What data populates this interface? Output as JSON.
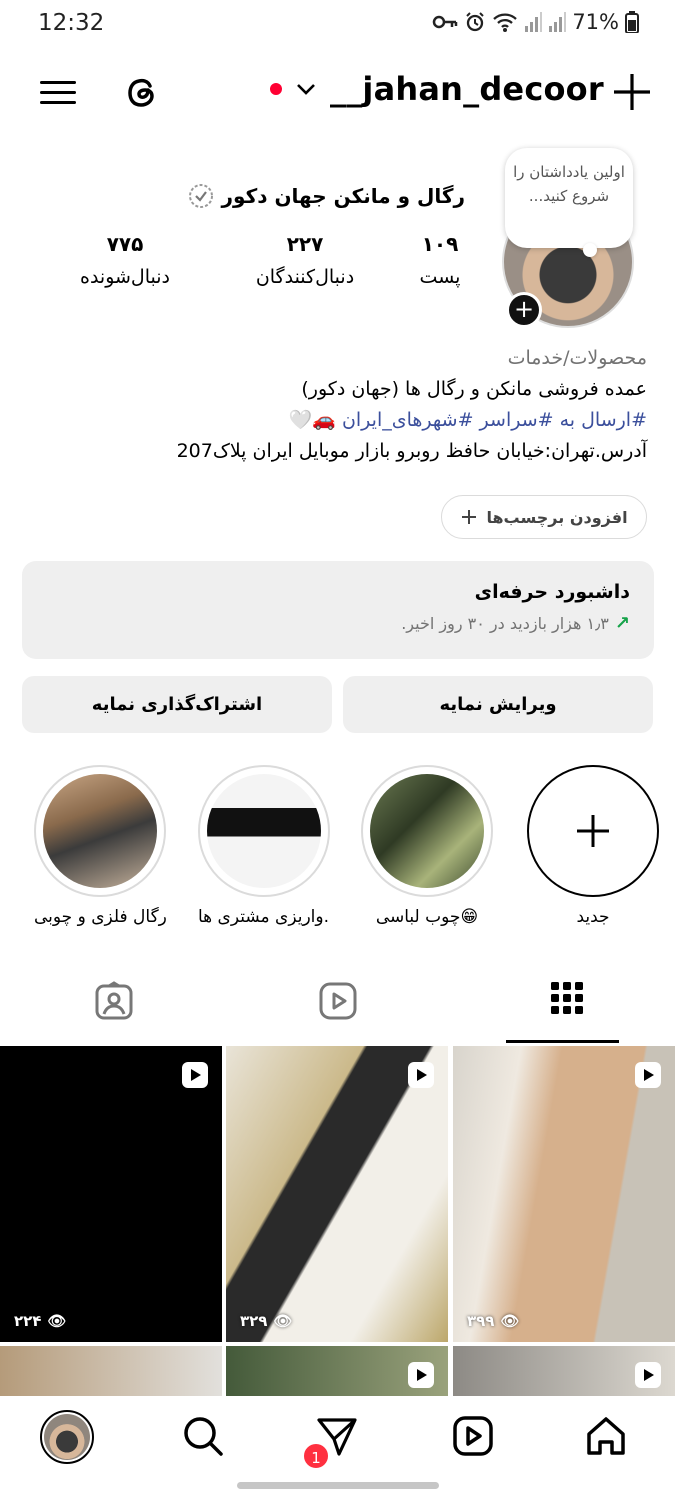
{
  "status_bar": {
    "time": "12:32",
    "battery": "71%"
  },
  "header": {
    "username": "__jahan_decoor"
  },
  "note": {
    "text": "اولین یادداشتان را شروع کنید..."
  },
  "profile": {
    "display_name": "رگال و مانکن جهان دکور",
    "stats": {
      "posts": {
        "value": "۱۰۹",
        "label": "پست"
      },
      "followers": {
        "value": "۲۲۷",
        "label": "دنبال‌کنندگان"
      },
      "following": {
        "value": "۷۷۵",
        "label": "دنبال‌شونده"
      }
    },
    "bio": {
      "category": "محصولات/خدمات",
      "line1": "عمده فروشی مانکن و رگال ها (جهان دکور)",
      "line2_prefix": "#ارسال به ",
      "line2_tags": "#سراسر #شهرهای_ایران",
      "line2_emojis": "🚗🤍",
      "line3": "آدرس.تهران:خیابان حافظ روبرو بازار موبایل ایران پلاک207"
    },
    "labels_button": "افزودن برچسب‌ها"
  },
  "dashboard": {
    "title": "داشبورد حرفه‌ای",
    "subtitle": "۱٫۳ هزار بازدید در ۳۰ روز اخیر."
  },
  "actions": {
    "edit": "ویرایش نمایه",
    "share": "اشتراک‌گذاری نمایه"
  },
  "highlights": [
    {
      "label": "جدید"
    },
    {
      "label": "چوب لباسی😁"
    },
    {
      "label": "واریزی مشتری ها..."
    },
    {
      "label": "رگال فلزی و چوبی"
    }
  ],
  "grid": [
    {
      "views": "۲۲۴"
    },
    {
      "views": "۳۲۹"
    },
    {
      "views": "۳۹۹"
    }
  ],
  "nav": {
    "badge": "1"
  },
  "colors": {
    "accent_red": "#ff0033",
    "link_blue": "#3b4f9c",
    "up_green": "#16a34a",
    "button_gray": "#efefef"
  }
}
